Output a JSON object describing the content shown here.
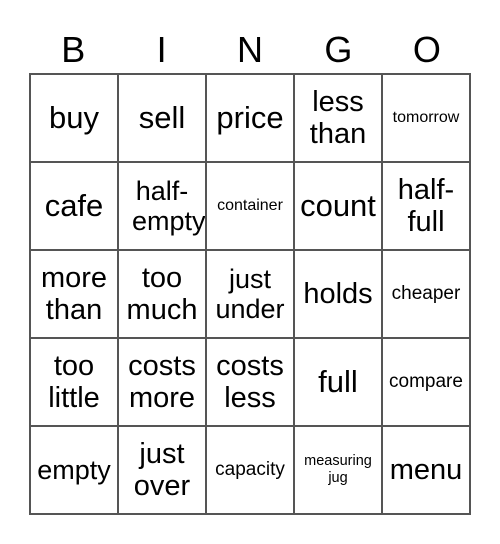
{
  "header": [
    "B",
    "I",
    "N",
    "G",
    "O"
  ],
  "cells": [
    {
      "text": "buy",
      "size": "xl"
    },
    {
      "text": "sell",
      "size": "xl"
    },
    {
      "text": "price",
      "size": "xl"
    },
    {
      "text": "less than",
      "size": "l"
    },
    {
      "text": "tomorrow",
      "size": "xs"
    },
    {
      "text": "cafe",
      "size": "xl"
    },
    {
      "text": "half-empty",
      "size": "m"
    },
    {
      "text": "container",
      "size": "xs"
    },
    {
      "text": "count",
      "size": "xl"
    },
    {
      "text": "half-full",
      "size": "l"
    },
    {
      "text": "more than",
      "size": "l"
    },
    {
      "text": "too much",
      "size": "l"
    },
    {
      "text": "just under",
      "size": "m"
    },
    {
      "text": "holds",
      "size": "l"
    },
    {
      "text": "cheaper",
      "size": "s"
    },
    {
      "text": "too little",
      "size": "l"
    },
    {
      "text": "costs more",
      "size": "l"
    },
    {
      "text": "costs less",
      "size": "l"
    },
    {
      "text": "full",
      "size": "xl"
    },
    {
      "text": "compare",
      "size": "s"
    },
    {
      "text": "empty",
      "size": "m"
    },
    {
      "text": "just over",
      "size": "l"
    },
    {
      "text": "capacity",
      "size": "s"
    },
    {
      "text": "measuring jug",
      "size": "xxs"
    },
    {
      "text": "menu",
      "size": "l"
    }
  ]
}
